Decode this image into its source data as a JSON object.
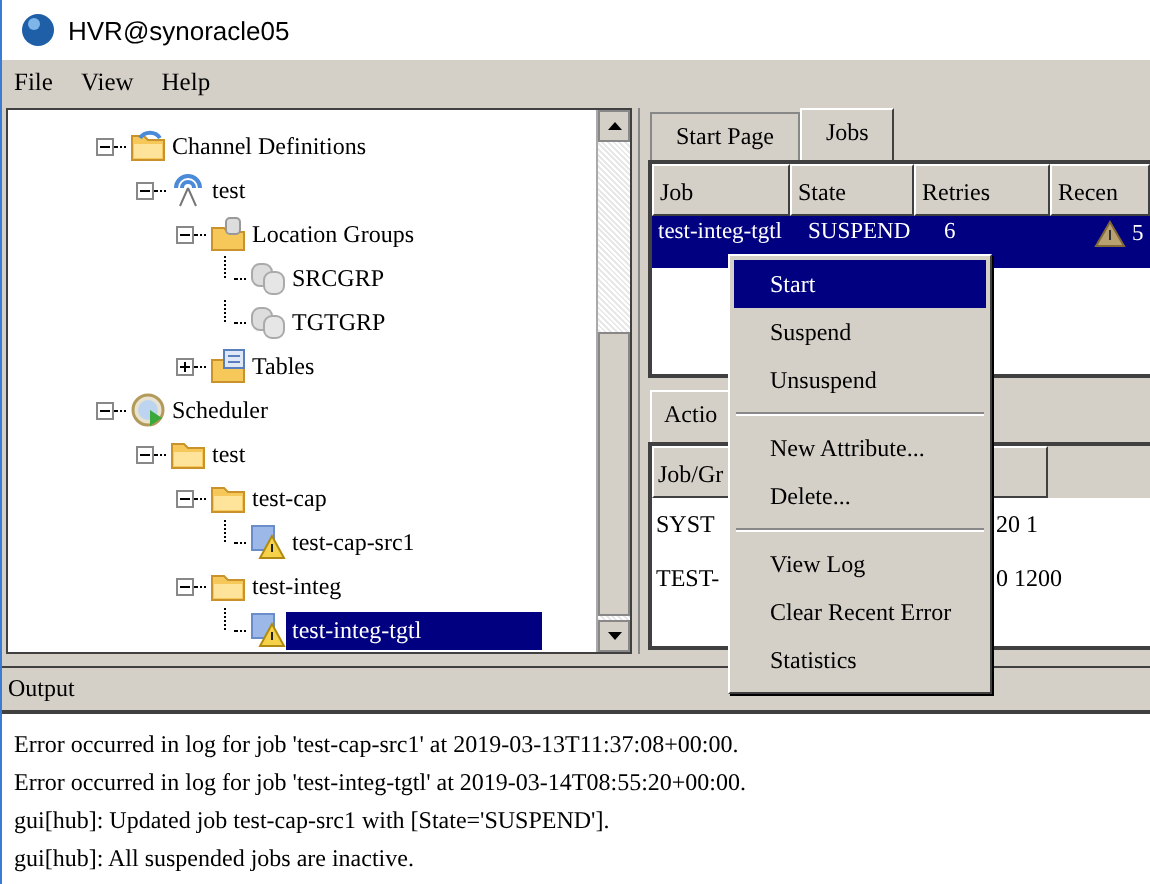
{
  "window": {
    "title": "HVR@synoracle05"
  },
  "menu": [
    {
      "label": "File"
    },
    {
      "label": "View"
    },
    {
      "label": "Help"
    }
  ],
  "tree": [
    {
      "label": "Channel Definitions",
      "kind": "folder-open",
      "expanded": true,
      "selected": false,
      "children": [
        {
          "label": "test",
          "kind": "antenna",
          "expanded": true,
          "selected": false,
          "children": [
            {
              "label": "Location Groups",
              "kind": "db-folder",
              "expanded": true,
              "selected": false,
              "children": [
                {
                  "label": "SRCGRP",
                  "kind": "db",
                  "selected": false
                },
                {
                  "label": "TGTGRP",
                  "kind": "db",
                  "selected": false
                }
              ]
            },
            {
              "label": "Tables",
              "kind": "table-folder",
              "expanded": false,
              "selected": false
            }
          ]
        }
      ]
    },
    {
      "label": "Scheduler",
      "kind": "scheduler",
      "expanded": true,
      "selected": false,
      "children": [
        {
          "label": "test",
          "kind": "folder",
          "expanded": true,
          "selected": false,
          "children": [
            {
              "label": "test-cap",
              "kind": "folder",
              "expanded": true,
              "selected": false,
              "children": [
                {
                  "label": "test-cap-src1",
                  "kind": "job-warning",
                  "selected": false
                }
              ]
            },
            {
              "label": "test-integ",
              "kind": "folder",
              "expanded": true,
              "selected": false,
              "children": [
                {
                  "label": "test-integ-tgtl",
                  "kind": "job-warning",
                  "selected": true
                }
              ]
            }
          ]
        }
      ]
    }
  ],
  "jobs_tabs": [
    {
      "label": "Start Page",
      "selected": false
    },
    {
      "label": "Jobs",
      "selected": true
    }
  ],
  "jobs_table": {
    "columns": [
      "Job",
      "State",
      "Retries",
      "Recen"
    ],
    "rows": [
      {
        "cells": [
          "test-integ-tgtl",
          "SUSPEND",
          "6",
          "5"
        ],
        "warning": true,
        "selected": true
      }
    ]
  },
  "action_tabs": [
    {
      "label": "Actio",
      "selected": true
    }
  ],
  "action_table": {
    "columns": [
      "Job/Gr"
    ],
    "rows": [
      [
        "SYST",
        "20 1"
      ],
      [
        "TEST-",
        "0 1200"
      ]
    ]
  },
  "context_menu": [
    {
      "kind": "item",
      "label": "Start",
      "selected": true
    },
    {
      "kind": "item",
      "label": "Suspend",
      "selected": false
    },
    {
      "kind": "item",
      "label": "Unsuspend",
      "selected": false
    },
    {
      "kind": "separator"
    },
    {
      "kind": "item",
      "label": "New Attribute...",
      "selected": false
    },
    {
      "kind": "item",
      "label": "Delete...",
      "selected": false
    },
    {
      "kind": "separator"
    },
    {
      "kind": "item",
      "label": "View Log",
      "selected": false
    },
    {
      "kind": "item",
      "label": "Clear Recent Error",
      "selected": false
    },
    {
      "kind": "item",
      "label": "Statistics",
      "selected": false
    }
  ],
  "output": {
    "title": "Output",
    "lines": [
      "Error occurred in log for job 'test-cap-src1' at 2019-03-13T11:37:08+00:00.",
      "Error occurred in log for job 'test-integ-tgtl' at 2019-03-14T08:55:20+00:00.",
      "gui[hub]: Updated job test-cap-src1 with [State='SUSPEND'].",
      "gui[hub]: All suspended jobs are inactive."
    ]
  }
}
